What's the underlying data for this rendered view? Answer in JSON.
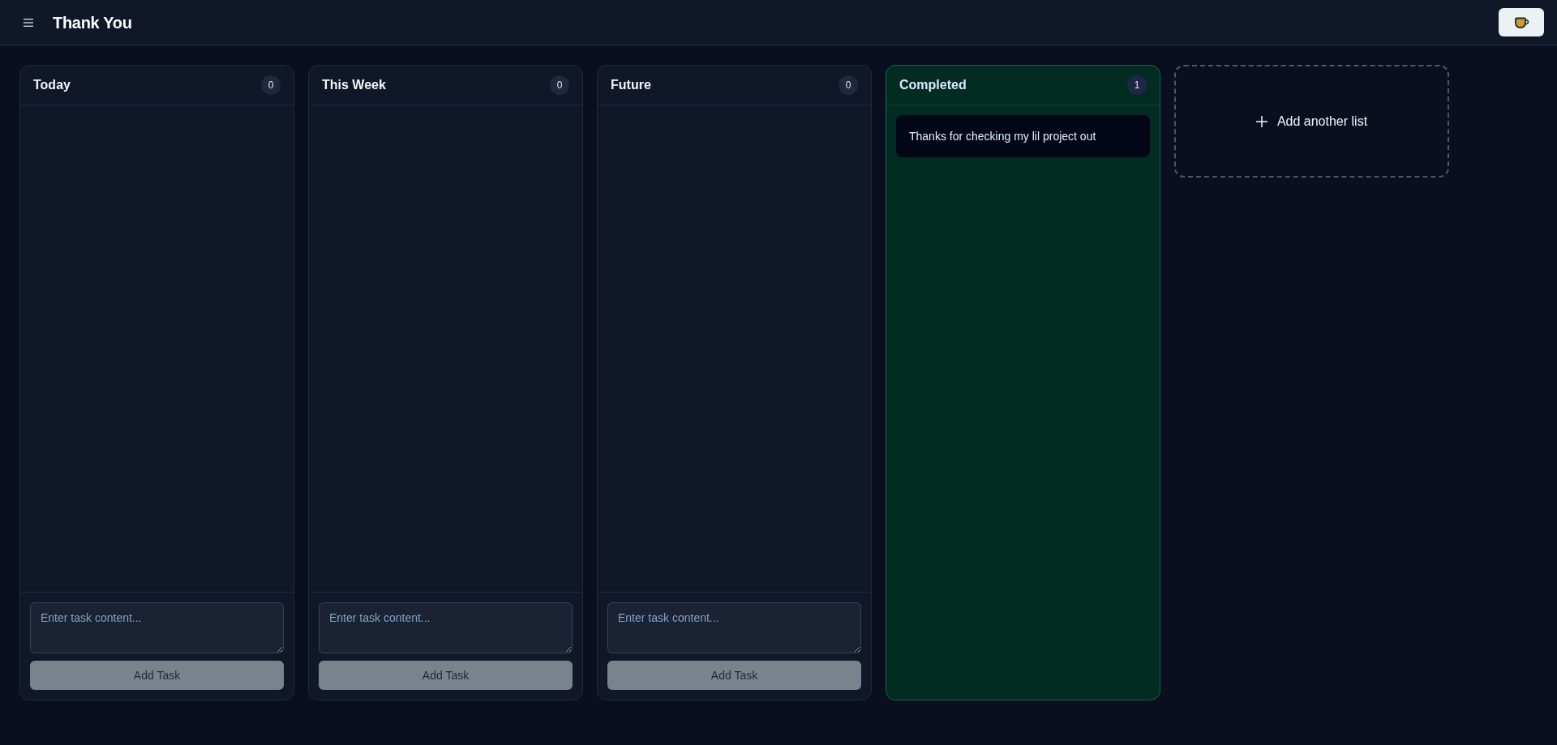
{
  "header": {
    "title": "Thank You"
  },
  "lists": [
    {
      "kind": "open",
      "title": "Today",
      "count": "0",
      "input": {
        "placeholder": "Enter task content..."
      },
      "add_button": {
        "label": "Add Task",
        "disabled": true
      }
    },
    {
      "kind": "open",
      "title": "This Week",
      "count": "0",
      "input": {
        "placeholder": "Enter task content..."
      },
      "add_button": {
        "label": "Add Task",
        "disabled": true
      }
    },
    {
      "kind": "open",
      "title": "Future",
      "count": "0",
      "input": {
        "placeholder": "Enter task content..."
      },
      "add_button": {
        "label": "Add Task",
        "disabled": true
      }
    },
    {
      "kind": "completed",
      "title": "Completed",
      "count": "1",
      "tasks": [
        "Thanks for checking my lil project out"
      ]
    }
  ],
  "add_list": {
    "label": "Add another list"
  }
}
